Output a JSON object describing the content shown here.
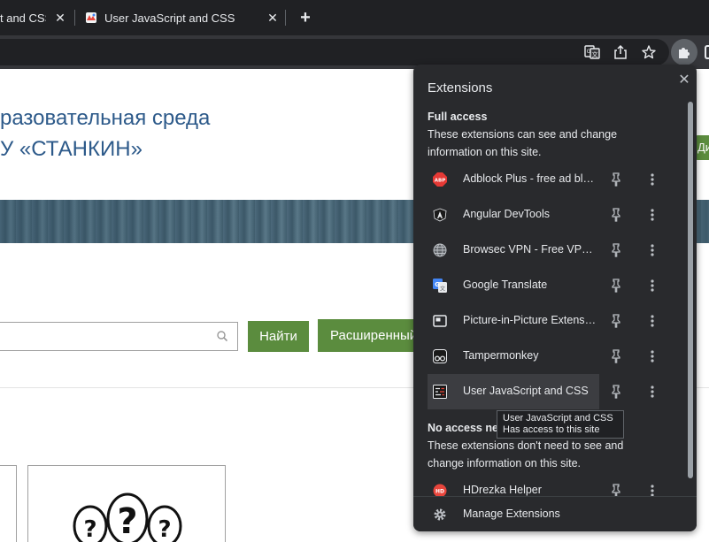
{
  "tabs": [
    {
      "title": "t and CSS",
      "close": "✕"
    },
    {
      "title": "User JavaScript and CSS",
      "close": "✕"
    }
  ],
  "new_tab": "+",
  "toolbar_icons": [
    "translate-icon",
    "share-icon",
    "star-icon",
    "puzzle-icon"
  ],
  "page": {
    "heading_line1": "разовательная среда",
    "heading_line2": "У «СТАНКИН»",
    "side_tab": "Ди",
    "search_button": "Найти",
    "advanced_button": "Расширенный"
  },
  "extensions_panel": {
    "title": "Extensions",
    "close": "✕",
    "full_access": {
      "heading": "Full access",
      "description": "These extensions can see and change information on this site."
    },
    "items": [
      {
        "name": "Adblock Plus - free ad blocker",
        "icon": "abp-icon"
      },
      {
        "name": "Angular DevTools",
        "icon": "angular-icon"
      },
      {
        "name": "Browsec VPN - Free VPN for Chrome",
        "icon": "globe-icon"
      },
      {
        "name": "Google Translate",
        "icon": "google-translate-icon"
      },
      {
        "name": "Picture-in-Picture Extension",
        "icon": "pip-icon"
      },
      {
        "name": "Tampermonkey",
        "icon": "tampermonkey-icon"
      },
      {
        "name": "User JavaScript and CSS",
        "icon": "user-js-css-icon"
      }
    ],
    "no_access": {
      "heading": "No access ne",
      "description": "These extensions don't need to see and change information on this site."
    },
    "no_access_items": [
      {
        "name": "HDrezka Helper",
        "icon": "hdrezka-icon"
      }
    ],
    "footer": {
      "label": "Manage Extensions",
      "icon": "gear-icon"
    },
    "tooltip": {
      "line1": "User JavaScript and CSS",
      "line2": "Has access to this site"
    }
  }
}
